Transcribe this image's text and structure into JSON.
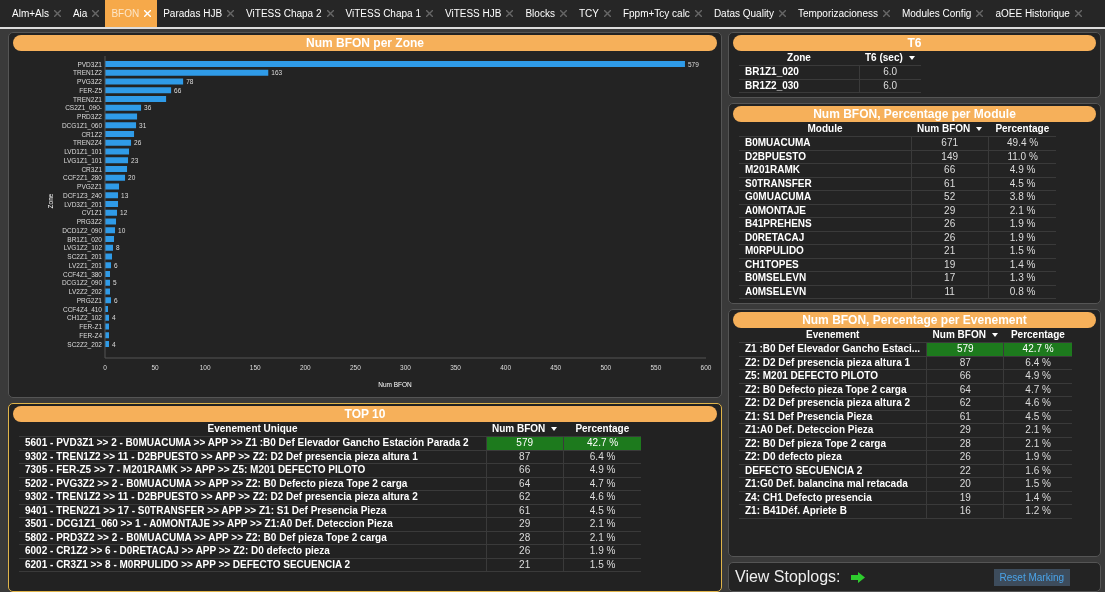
{
  "tabs": [
    {
      "label": "Alm+Als",
      "selected": false
    },
    {
      "label": "Aia",
      "selected": false
    },
    {
      "label": "BFON",
      "selected": true
    },
    {
      "label": "Paradas HJB",
      "selected": false
    },
    {
      "label": "ViTESS Chapa 2",
      "selected": false
    },
    {
      "label": "ViTESS Chapa 1",
      "selected": false
    },
    {
      "label": "ViTESS HJB",
      "selected": false
    },
    {
      "label": "Blocks",
      "selected": false
    },
    {
      "label": "TCY",
      "selected": false
    },
    {
      "label": "Fppm+Tcy calc",
      "selected": false
    },
    {
      "label": "Datas Quality",
      "selected": false
    },
    {
      "label": "Temporizacioness",
      "selected": false
    },
    {
      "label": "Modules Config",
      "selected": false
    },
    {
      "label": "aOEE Historique",
      "selected": false
    }
  ],
  "zone_panel": {
    "title": "Num BFON per Zone",
    "chart_data": {
      "type": "bar",
      "orientation": "horizontal",
      "xlabel": "Num BFON",
      "ylabel": "Zone",
      "xlim": [
        0,
        600
      ],
      "xticks": [
        0,
        50,
        100,
        150,
        200,
        250,
        300,
        350,
        400,
        450,
        500,
        550,
        600
      ],
      "categories": [
        "PVD3Z1",
        "TREN1Z2",
        "PVG3Z2",
        "FER-Z5",
        "TREN2Z1",
        "CS2Z1_090-",
        "PRD3Z2",
        "DCG1Z1_060",
        "CR1Z2",
        "TREN2Z4",
        "LVD1Z1_101",
        "LVG1Z1_101",
        "CR3Z1",
        "CCF2Z1_280",
        "PVG2Z1",
        "DCF1Z3_240",
        "LVD3Z1_201",
        "CV1Z1",
        "PRG3Z2",
        "DCD1Z2_090",
        "BR1Z1_020",
        "LVG1Z2_102",
        "SC2Z1_201",
        "LV2Z1_201",
        "CCF4Z1_380",
        "DCG1Z2_090",
        "LV2Z2_202",
        "PRG2Z1",
        "CCF4Z4_410",
        "CH1Z2_102",
        "FER-Z1",
        "FER-Z4",
        "SC2Z2_202"
      ],
      "series": [
        {
          "color": "#2f9be8",
          "values": [
            579,
            163,
            78,
            66,
            61,
            36,
            32,
            31,
            29,
            26,
            24,
            23,
            22,
            20,
            14,
            13,
            13,
            12,
            11,
            10,
            9,
            8,
            7,
            6,
            5,
            5,
            5,
            6,
            3,
            4,
            4,
            4,
            4
          ]
        }
      ],
      "value_labels": [
        "579",
        "163",
        "78",
        "66",
        null,
        "36",
        null,
        "31",
        null,
        "26",
        null,
        "23",
        null,
        "20",
        null,
        "13",
        null,
        "12",
        null,
        "10",
        null,
        "8",
        null,
        "6",
        null,
        "5",
        null,
        "6",
        null,
        "4",
        null,
        null,
        "4"
      ]
    }
  },
  "top10": {
    "title": "TOP 10",
    "columns": [
      {
        "label": "Evenement Unique",
        "sorted": false
      },
      {
        "label": "Num BFON",
        "sorted": true
      },
      {
        "label": "Percentage",
        "sorted": false
      }
    ],
    "rows": [
      {
        "cells": [
          "5601 - PVD3Z1 >> 2 - B0MUACUMA >> APP >> Z1 :B0 Def Elevador Gancho Estación Parada 2",
          "579",
          "42.7 %"
        ],
        "highlighted": true
      },
      {
        "cells": [
          "9302 - TREN1Z2 >> 11 - D2BPUESTO >> APP >> Z2: D2 Def presencia pieza altura 1",
          "87",
          "6.4 %"
        ],
        "highlighted": false
      },
      {
        "cells": [
          "7305 - FER-Z5 >> 7 - M201RAMK >> APP >> Z5: M201 DEFECTO PILOTO",
          "66",
          "4.9 %"
        ],
        "highlighted": false
      },
      {
        "cells": [
          "5202 - PVG3Z2 >> 2 - B0MUACUMA >> APP >> Z2: B0 Defecto pieza Tope 2 carga",
          "64",
          "4.7 %"
        ],
        "highlighted": false
      },
      {
        "cells": [
          "9302 - TREN1Z2 >> 11 - D2BPUESTO >> APP >> Z2: D2 Def presencia pieza altura 2",
          "62",
          "4.6 %"
        ],
        "highlighted": false
      },
      {
        "cells": [
          "9401 - TREN2Z1 >> 17 - S0TRANSFER >> APP >> Z1: S1 Def Presencia Pieza",
          "61",
          "4.5 %"
        ],
        "highlighted": false
      },
      {
        "cells": [
          "3501 - DCG1Z1_060 >> 1 - A0MONTAJE >> APP >> Z1:A0 Def. Deteccion Pieza",
          "29",
          "2.1 %"
        ],
        "highlighted": false
      },
      {
        "cells": [
          "5802 - PRD3Z2 >> 2 - B0MUACUMA >> APP >> Z2: B0 Def pieza Tope 2 carga",
          "28",
          "2.1 %"
        ],
        "highlighted": false
      },
      {
        "cells": [
          "6002 - CR1Z2 >> 6 - D0RETACAJ >> APP >> Z2: D0 defecto pieza",
          "26",
          "1.9 %"
        ],
        "highlighted": false
      },
      {
        "cells": [
          "6201 - CR3Z1 >> 8 - M0RPULIDO >> APP >> DEFECTO SECUENCIA 2",
          "21",
          "1.5 %"
        ],
        "highlighted": false
      }
    ]
  },
  "t6": {
    "title": "T6",
    "columns": [
      {
        "label": "Zone",
        "sorted": false
      },
      {
        "label": "T6 (sec)",
        "sorted": true
      }
    ],
    "rows": [
      {
        "cells": [
          "BR1Z1_020",
          "6.0"
        ],
        "highlighted": false
      },
      {
        "cells": [
          "BR1Z2_030",
          "6.0"
        ],
        "highlighted": false
      }
    ]
  },
  "modules": {
    "title": "Num BFON, Percentage per Module",
    "columns": [
      {
        "label": "Module",
        "sorted": false
      },
      {
        "label": "Num BFON",
        "sorted": true
      },
      {
        "label": "Percentage",
        "sorted": false
      }
    ],
    "rows": [
      {
        "cells": [
          "B0MUACUMA",
          "671",
          "49.4 %"
        ],
        "highlighted": false
      },
      {
        "cells": [
          "D2BPUESTO",
          "149",
          "11.0 %"
        ],
        "highlighted": false
      },
      {
        "cells": [
          "M201RAMK",
          "66",
          "4.9 %"
        ],
        "highlighted": false
      },
      {
        "cells": [
          "S0TRANSFER",
          "61",
          "4.5 %"
        ],
        "highlighted": false
      },
      {
        "cells": [
          "G0MUACUMA",
          "52",
          "3.8 %"
        ],
        "highlighted": false
      },
      {
        "cells": [
          "A0MONTAJE",
          "29",
          "2.1 %"
        ],
        "highlighted": false
      },
      {
        "cells": [
          "B41PREHENS",
          "26",
          "1.9 %"
        ],
        "highlighted": false
      },
      {
        "cells": [
          "D0RETACAJ",
          "26",
          "1.9 %"
        ],
        "highlighted": false
      },
      {
        "cells": [
          "M0RPULIDO",
          "21",
          "1.5 %"
        ],
        "highlighted": false
      },
      {
        "cells": [
          "CH1TOPES",
          "19",
          "1.4 %"
        ],
        "highlighted": false
      },
      {
        "cells": [
          "B0MSELEVN",
          "17",
          "1.3 %"
        ],
        "highlighted": false
      },
      {
        "cells": [
          "A0MSELEVN",
          "11",
          "0.8 %"
        ],
        "highlighted": false
      }
    ]
  },
  "evenements": {
    "title": "Num BFON, Percentage per Evenement",
    "columns": [
      {
        "label": "Evenement",
        "sorted": false
      },
      {
        "label": "Num BFON",
        "sorted": true
      },
      {
        "label": "Percentage",
        "sorted": false
      }
    ],
    "rows": [
      {
        "cells": [
          "Z1 :B0 Def Elevador Gancho Estaci...",
          "579",
          "42.7 %"
        ],
        "highlighted": true
      },
      {
        "cells": [
          "Z2: D2 Def presencia pieza altura 1",
          "87",
          "6.4 %"
        ],
        "highlighted": false
      },
      {
        "cells": [
          "Z5: M201 DEFECTO PILOTO",
          "66",
          "4.9 %"
        ],
        "highlighted": false
      },
      {
        "cells": [
          "Z2: B0 Defecto pieza Tope 2 carga",
          "64",
          "4.7 %"
        ],
        "highlighted": false
      },
      {
        "cells": [
          "Z2: D2 Def presencia pieza altura 2",
          "62",
          "4.6 %"
        ],
        "highlighted": false
      },
      {
        "cells": [
          "Z1: S1 Def Presencia Pieza",
          "61",
          "4.5 %"
        ],
        "highlighted": false
      },
      {
        "cells": [
          "Z1:A0 Def. Deteccion Pieza",
          "29",
          "2.1 %"
        ],
        "highlighted": false
      },
      {
        "cells": [
          "Z2: B0 Def pieza Tope 2 carga",
          "28",
          "2.1 %"
        ],
        "highlighted": false
      },
      {
        "cells": [
          "Z2: D0 defecto pieza",
          "26",
          "1.9 %"
        ],
        "highlighted": false
      },
      {
        "cells": [
          "DEFECTO SECUENCIA 2",
          "22",
          "1.6 %"
        ],
        "highlighted": false
      },
      {
        "cells": [
          "Z1:G0 Def. balancina mal retacada",
          "20",
          "1.5 %"
        ],
        "highlighted": false
      },
      {
        "cells": [
          "Z4: CH1 Defecto presencia",
          "19",
          "1.4 %"
        ],
        "highlighted": false
      },
      {
        "cells": [
          "Z1: B41Déf. Apriete B",
          "16",
          "1.2 %"
        ],
        "highlighted": false
      }
    ]
  },
  "stoplogs": {
    "label": "View Stoplogs:",
    "button": "Reset Marking"
  }
}
